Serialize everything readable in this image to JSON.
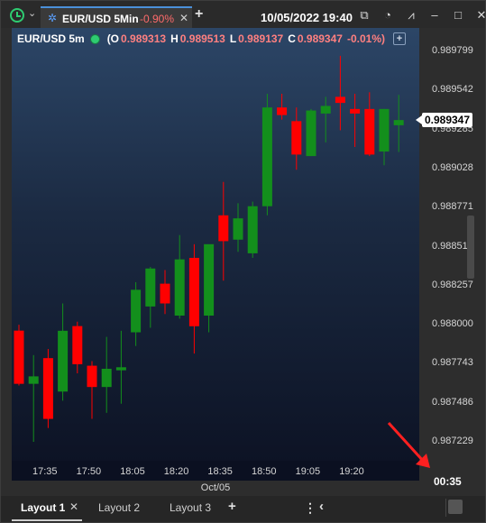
{
  "titlebar": {
    "tab_title": "EUR/USD 5Min",
    "tab_change": "-0.90%",
    "tab_close": "✕",
    "add_tab": "+",
    "datetime": "10/05/2022 19:40",
    "icons": [
      "clone-icon",
      "clock-icon",
      "zigzag-icon",
      "minimize-icon",
      "maximize-icon",
      "close-icon"
    ]
  },
  "symbol_bar": {
    "symbol": "EUR/USD 5m",
    "ohlc_open_paren": "(O",
    "open": "0.989313",
    "high_label": "H",
    "high": "0.989513",
    "low_label": "L",
    "low": "0.989137",
    "close_label": "C",
    "close": "0.989347",
    "change": "-0.01%)",
    "add": "+"
  },
  "price_axis": {
    "labels": [
      "0.989799",
      "0.989542",
      "0.989285",
      "0.989028",
      "0.988771",
      "0.988514",
      "0.988257",
      "0.988000",
      "0.987743",
      "0.987486",
      "0.987229"
    ],
    "current_price": "0.989347"
  },
  "time_axis": {
    "labels": [
      "17:35",
      "17:50",
      "18:05",
      "18:20",
      "18:35",
      "18:50",
      "19:05",
      "19:20"
    ],
    "date": "Oct/05",
    "countdown": "00:35"
  },
  "layout_bar": {
    "tabs": [
      "Layout 1",
      "Layout 2",
      "Layout 3"
    ],
    "close": "✕",
    "add": "+",
    "more": "⋮",
    "prev": "‹"
  },
  "colors": {
    "up": "#138f1c",
    "down": "#ff0000",
    "accent": "#2ecc71",
    "change_negative": "#ff6b6b"
  },
  "chart_data": {
    "type": "candlestick",
    "title": "",
    "xlabel": "",
    "ylabel": "",
    "ylim": [
      0.98705,
      0.98995
    ],
    "candles": [
      {
        "o": 0.987961,
        "h": 0.988,
        "l": 0.9876,
        "c": 0.987611
      },
      {
        "o": 0.987611,
        "h": 0.9878,
        "l": 0.987229,
        "c": 0.98766
      },
      {
        "o": 0.98778,
        "h": 0.98784,
        "l": 0.98732,
        "c": 0.98738
      },
      {
        "o": 0.98756,
        "h": 0.98814,
        "l": 0.9875,
        "c": 0.98796
      },
      {
        "o": 0.987991,
        "h": 0.98802,
        "l": 0.98768,
        "c": 0.98774
      },
      {
        "o": 0.98773,
        "h": 0.98776,
        "l": 0.98738,
        "c": 0.98759
      },
      {
        "o": 0.98759,
        "h": 0.98792,
        "l": 0.98742,
        "c": 0.98771
      },
      {
        "o": 0.9877,
        "h": 0.98796,
        "l": 0.98748,
        "c": 0.98772
      },
      {
        "o": 0.98795,
        "h": 0.98828,
        "l": 0.98786,
        "c": 0.98823
      },
      {
        "o": 0.98812,
        "h": 0.98838,
        "l": 0.98798,
        "c": 0.98837
      },
      {
        "o": 0.98827,
        "h": 0.98836,
        "l": 0.98807,
        "c": 0.98814
      },
      {
        "o": 0.98806,
        "h": 0.98859,
        "l": 0.98804,
        "c": 0.98843
      },
      {
        "o": 0.98844,
        "h": 0.98853,
        "l": 0.98781,
        "c": 0.98799
      },
      {
        "o": 0.98806,
        "h": 0.9884,
        "l": 0.98795,
        "c": 0.98853
      },
      {
        "o": 0.98872,
        "h": 0.98894,
        "l": 0.98829,
        "c": 0.98855
      },
      {
        "o": 0.98856,
        "h": 0.9888,
        "l": 0.98848,
        "c": 0.9887
      },
      {
        "o": 0.98847,
        "h": 0.98881,
        "l": 0.98844,
        "c": 0.98878
      },
      {
        "o": 0.98878,
        "h": 0.98952,
        "l": 0.98872,
        "c": 0.98943
      },
      {
        "o": 0.98943,
        "h": 0.98952,
        "l": 0.98935,
        "c": 0.98938
      },
      {
        "o": 0.98934,
        "h": 0.98943,
        "l": 0.98902,
        "c": 0.98912
      },
      {
        "o": 0.98911,
        "h": 0.98942,
        "l": 0.98911,
        "c": 0.98941
      },
      {
        "o": 0.98939,
        "h": 0.9895,
        "l": 0.9892,
        "c": 0.98944
      },
      {
        "o": 0.9895,
        "h": 0.98977,
        "l": 0.98928,
        "c": 0.98946
      },
      {
        "o": 0.98942,
        "h": 0.98952,
        "l": 0.98917,
        "c": 0.98939
      },
      {
        "o": 0.98942,
        "h": 0.98953,
        "l": 0.98911,
        "c": 0.98912
      },
      {
        "o": 0.98914,
        "h": 0.98942,
        "l": 0.98905,
        "c": 0.98942
      },
      {
        "o": 0.989313,
        "h": 0.989513,
        "l": 0.989137,
        "c": 0.989347
      }
    ]
  }
}
